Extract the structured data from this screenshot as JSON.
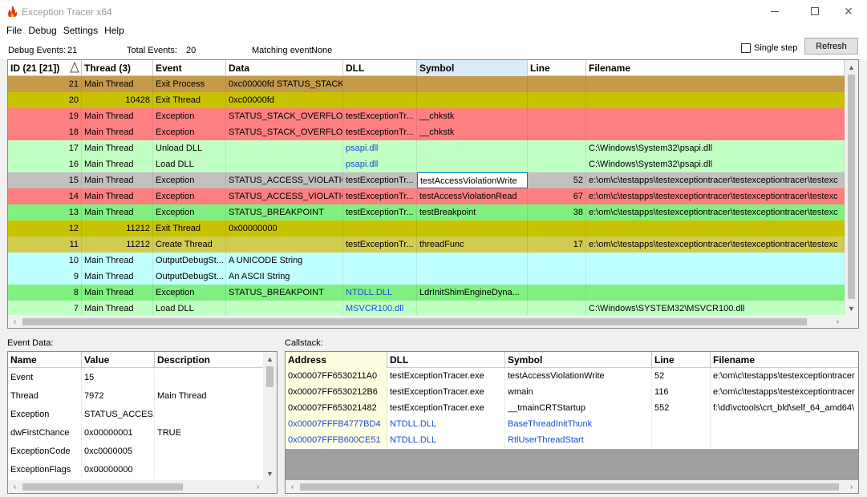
{
  "window": {
    "title": "Exception Tracer x64",
    "app_icon": "flame-icon"
  },
  "menu": [
    "File",
    "Debug",
    "Settings",
    "Help"
  ],
  "info": {
    "debug_events_label": "Debug Events:",
    "debug_events_value": "21",
    "total_events_label": "Total Events:",
    "total_events_value": "20",
    "matching_label": "Matching event:",
    "matching_value": "None",
    "single_step": "Single step",
    "refresh": "Refresh"
  },
  "events": {
    "columns": [
      "ID (21 [21])",
      "Thread (3)",
      "Event",
      "Data",
      "DLL",
      "Symbol",
      "Line",
      "Filename"
    ],
    "rows": [
      {
        "id": "21",
        "thread": "Main Thread",
        "event": "Exit Process",
        "data": "0xc00000fd STATUS_STACK_...",
        "dll": "",
        "symbol": "",
        "line": "",
        "file": "",
        "color": "#c49a4b"
      },
      {
        "id": "20",
        "thread": "10428",
        "event": "Exit Thread",
        "data": "0xc00000fd",
        "dll": "",
        "symbol": "",
        "line": "",
        "file": "",
        "color": "#c8c200"
      },
      {
        "id": "19",
        "thread": "Main Thread",
        "event": "Exception",
        "data": "STATUS_STACK_OVERFLOW",
        "dll": "testExceptionTr...",
        "symbol": "__chkstk",
        "line": "",
        "file": "",
        "color": "#ff8080"
      },
      {
        "id": "18",
        "thread": "Main Thread",
        "event": "Exception",
        "data": "STATUS_STACK_OVERFLOW",
        "dll": "testExceptionTr...",
        "symbol": "__chkstk",
        "line": "",
        "file": "",
        "color": "#ff8080"
      },
      {
        "id": "17",
        "thread": "Main Thread",
        "event": "Unload DLL",
        "data": "",
        "dll": "psapi.dll",
        "symbol": "",
        "line": "",
        "file": "C:\\Windows\\System32\\psapi.dll",
        "color": "#c2ffc2",
        "dll_link": true
      },
      {
        "id": "16",
        "thread": "Main Thread",
        "event": "Load DLL",
        "data": "",
        "dll": "psapi.dll",
        "symbol": "",
        "line": "",
        "file": "C:\\Windows\\System32\\psapi.dll",
        "color": "#c2ffc2",
        "dll_link": true
      },
      {
        "id": "15",
        "thread": "Main Thread",
        "event": "Exception",
        "data": "STATUS_ACCESS_VIOLATION",
        "dll": "testExceptionTr...",
        "symbol": "testAccessViolationWrite",
        "line": "52",
        "file": "e:\\om\\c\\testapps\\testexceptiontracer\\testexceptiontracer\\testexc",
        "color": "#c0c0c0",
        "selected": true
      },
      {
        "id": "14",
        "thread": "Main Thread",
        "event": "Exception",
        "data": "STATUS_ACCESS_VIOLATION",
        "dll": "testExceptionTr...",
        "symbol": "testAccessViolationRead",
        "line": "67",
        "file": "e:\\om\\c\\testapps\\testexceptiontracer\\testexceptiontracer\\testexc",
        "color": "#ff8080"
      },
      {
        "id": "13",
        "thread": "Main Thread",
        "event": "Exception",
        "data": "STATUS_BREAKPOINT",
        "dll": "testExceptionTr...",
        "symbol": "testBreakpoint",
        "line": "38",
        "file": "e:\\om\\c\\testapps\\testexceptiontracer\\testexceptiontracer\\testexc",
        "color": "#80f080"
      },
      {
        "id": "12",
        "thread": "11212",
        "event": "Exit Thread",
        "data": "0x00000000",
        "dll": "",
        "symbol": "",
        "line": "",
        "file": "",
        "color": "#c8c200"
      },
      {
        "id": "11",
        "thread": "11212",
        "event": "Create Thread",
        "data": "",
        "dll": "testExceptionTr...",
        "symbol": "threadFunc",
        "line": "17",
        "file": "e:\\om\\c\\testapps\\testexceptiontracer\\testexceptiontracer\\testexc",
        "color": "#d0cc50"
      },
      {
        "id": "10",
        "thread": "Main Thread",
        "event": "OutputDebugSt...",
        "data": "A UNICODE String",
        "dll": "",
        "symbol": "",
        "line": "",
        "file": "",
        "color": "#c0ffff"
      },
      {
        "id": "9",
        "thread": "Main Thread",
        "event": "OutputDebugSt...",
        "data": "An ASCII String",
        "dll": "",
        "symbol": "",
        "line": "",
        "file": "",
        "color": "#c0ffff"
      },
      {
        "id": "8",
        "thread": "Main Thread",
        "event": "Exception",
        "data": "STATUS_BREAKPOINT",
        "dll": "NTDLL.DLL",
        "symbol": "LdrInitShimEngineDyna...",
        "line": "",
        "file": "",
        "color": "#80f080",
        "dll_link": true
      },
      {
        "id": "7",
        "thread": "Main Thread",
        "event": "Load DLL",
        "data": "",
        "dll": "MSVCR100.dll",
        "symbol": "",
        "line": "",
        "file": "C:\\Windows\\SYSTEM32\\MSVCR100.dll",
        "color": "#c2ffc2",
        "dll_link": true
      }
    ]
  },
  "event_data": {
    "label": "Event Data:",
    "columns": [
      "Name",
      "Value",
      "Description"
    ],
    "rows": [
      {
        "name": "Event",
        "value": "15",
        "desc": ""
      },
      {
        "name": "Thread",
        "value": "7972",
        "desc": "Main Thread"
      },
      {
        "name": "Exception",
        "value": "STATUS_ACCES...",
        "desc": ""
      },
      {
        "name": "dwFirstChance",
        "value": "0x00000001",
        "desc": "TRUE"
      },
      {
        "name": "ExceptionCode",
        "value": "0xc0000005",
        "desc": ""
      },
      {
        "name": "ExceptionFlags",
        "value": "0x00000000",
        "desc": ""
      }
    ]
  },
  "callstack": {
    "label": "Callstack:",
    "columns": [
      "Address",
      "DLL",
      "Symbol",
      "Line",
      "Filename"
    ],
    "rows": [
      {
        "addr": "0x00007FF6530211A0",
        "dll": "testExceptionTracer.exe",
        "symbol": "testAccessViolationWrite",
        "line": "52",
        "file": "e:\\om\\c\\testapps\\testexceptiontracer",
        "link": false
      },
      {
        "addr": "0x00007FF6530212B6",
        "dll": "testExceptionTracer.exe",
        "symbol": "wmain",
        "line": "116",
        "file": "e:\\om\\c\\testapps\\testexceptiontracer",
        "link": false
      },
      {
        "addr": "0x00007FF653021482",
        "dll": "testExceptionTracer.exe",
        "symbol": "__tmainCRTStartup",
        "line": "552",
        "file": "f:\\dd\\vctools\\crt_bld\\self_64_amd64\\",
        "link": false
      },
      {
        "addr": "0x00007FFFB4777BD4",
        "dll": "NTDLL.DLL",
        "symbol": "BaseThreadInitThunk",
        "line": "",
        "file": "",
        "link": true
      },
      {
        "addr": "0x00007FFFB600CE51",
        "dll": "NTDLL.DLL",
        "symbol": "RtlUserThreadStart",
        "line": "",
        "file": "",
        "link": true
      }
    ]
  }
}
